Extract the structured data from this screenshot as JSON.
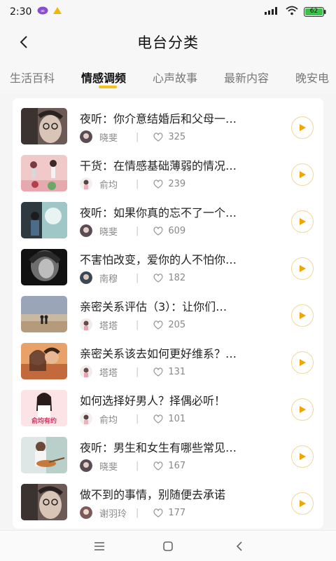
{
  "status": {
    "time": "2:30",
    "battery": "62"
  },
  "header": {
    "title": "电台分类"
  },
  "tabs": [
    {
      "label": "生活百科",
      "active": false
    },
    {
      "label": "情感调频",
      "active": true
    },
    {
      "label": "心声故事",
      "active": false
    },
    {
      "label": "最新内容",
      "active": false
    },
    {
      "label": "晚安电",
      "active": false
    }
  ],
  "items": [
    {
      "title": "夜听：你介意结婚后和父母一…",
      "author": "晓斐",
      "count": "325"
    },
    {
      "title": "干货：在情感基础薄弱的情况…",
      "author": "俞均",
      "count": "239"
    },
    {
      "title": "夜听：如果你真的忘不了一个…",
      "author": "晓斐",
      "count": "609"
    },
    {
      "title": "不害怕改变，爱你的人不怕你…",
      "author": "南穆",
      "count": "182"
    },
    {
      "title": "亲密关系评估（3）：让你们…",
      "author": "塔塔",
      "count": "205"
    },
    {
      "title": "亲密关系该去如何更好维系？…",
      "author": "塔塔",
      "count": "131"
    },
    {
      "title": "如何选择好男人？择偶必听！",
      "author": "俞均",
      "count": "101",
      "thumb_text": "俞均有约"
    },
    {
      "title": "夜听：男生和女生有哪些常见…",
      "author": "晓斐",
      "count": "167"
    },
    {
      "title": "做不到的事情，别随便去承诺",
      "author": "谢羽玲",
      "count": "177"
    }
  ],
  "colors": {
    "accent": "#f6c21c",
    "play_arrow": "#f0a500",
    "play_border": "#f0d89a"
  },
  "icons": {
    "back": "back-arrow-icon",
    "play": "play-icon",
    "heat": "heat-icon",
    "menu": "menu-icon",
    "home": "home-icon",
    "nav_back": "nav-back-icon"
  }
}
